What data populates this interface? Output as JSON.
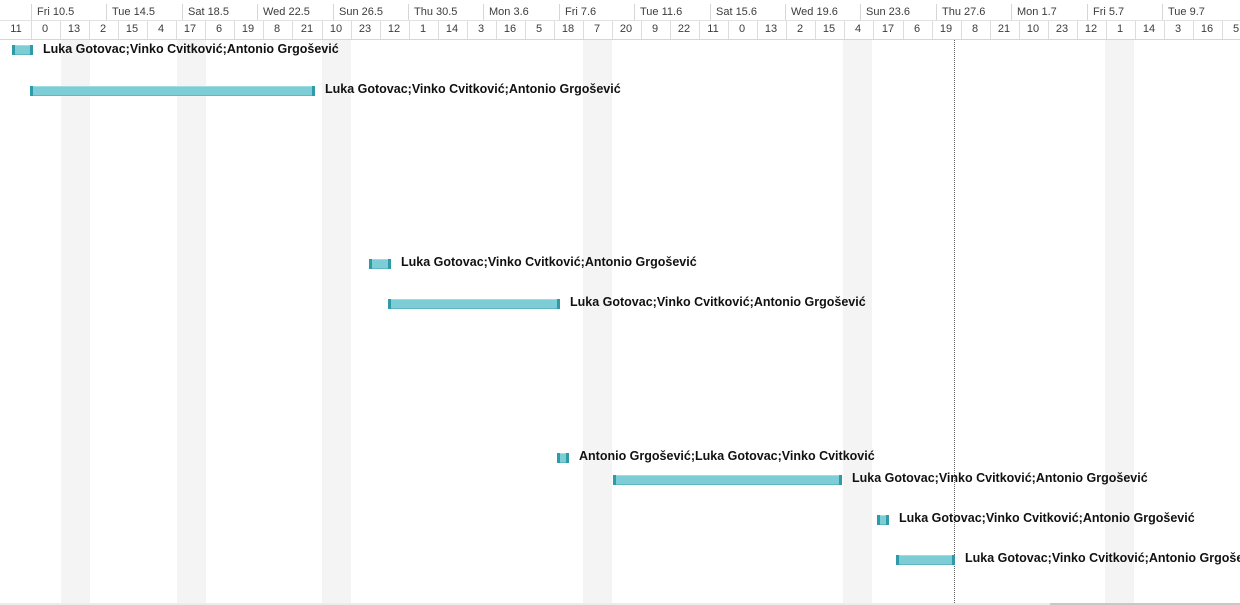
{
  "timeline": {
    "weeks": [
      "Fri 10.5",
      "Tue 14.5",
      "Sat 18.5",
      "Wed 22.5",
      "Sun 26.5",
      "Thu 30.5",
      "Mon 3.6",
      "Fri 7.6",
      "Tue 11.6",
      "Sat 15.6",
      "Wed 19.6",
      "Sun 23.6",
      "Thu 27.6",
      "Mon 1.7",
      "Fri 5.7",
      "Tue 9.7"
    ],
    "ticks": [
      "11",
      "0",
      "13",
      "2",
      "15",
      "4",
      "17",
      "6",
      "19",
      "8",
      "21",
      "10",
      "23",
      "12",
      "1",
      "14",
      "3",
      "16",
      "5",
      "18",
      "7",
      "20",
      "9",
      "22",
      "11",
      "0",
      "13",
      "2",
      "15",
      "4",
      "17",
      "6",
      "19",
      "8",
      "21",
      "10",
      "23",
      "12",
      "1",
      "14",
      "3",
      "16",
      "5"
    ]
  },
  "tasks": [
    {
      "label": "Luka Gotovac;Vinko Cvitković;Antonio Grgošević"
    },
    {
      "label": "Luka Gotovac;Vinko Cvitković;Antonio Grgošević"
    },
    {
      "label": "Luka Gotovac;Vinko Cvitković;Antonio Grgošević"
    },
    {
      "label": "Luka Gotovac;Vinko Cvitković;Antonio Grgošević"
    },
    {
      "label": "Antonio Grgošević;Luka Gotovac;Vinko Cvitković"
    },
    {
      "label": "Luka Gotovac;Vinko Cvitković;Antonio Grgošević"
    },
    {
      "label": "Luka Gotovac;Vinko Cvitković;Antonio Grgošević"
    },
    {
      "label": "Luka Gotovac;Vinko Cvitković;Antonio Grgošević"
    }
  ],
  "colors": {
    "bar": "#7ccdd6",
    "bar_edge": "#2f9aa8",
    "weekend": "#f4f4f4"
  }
}
